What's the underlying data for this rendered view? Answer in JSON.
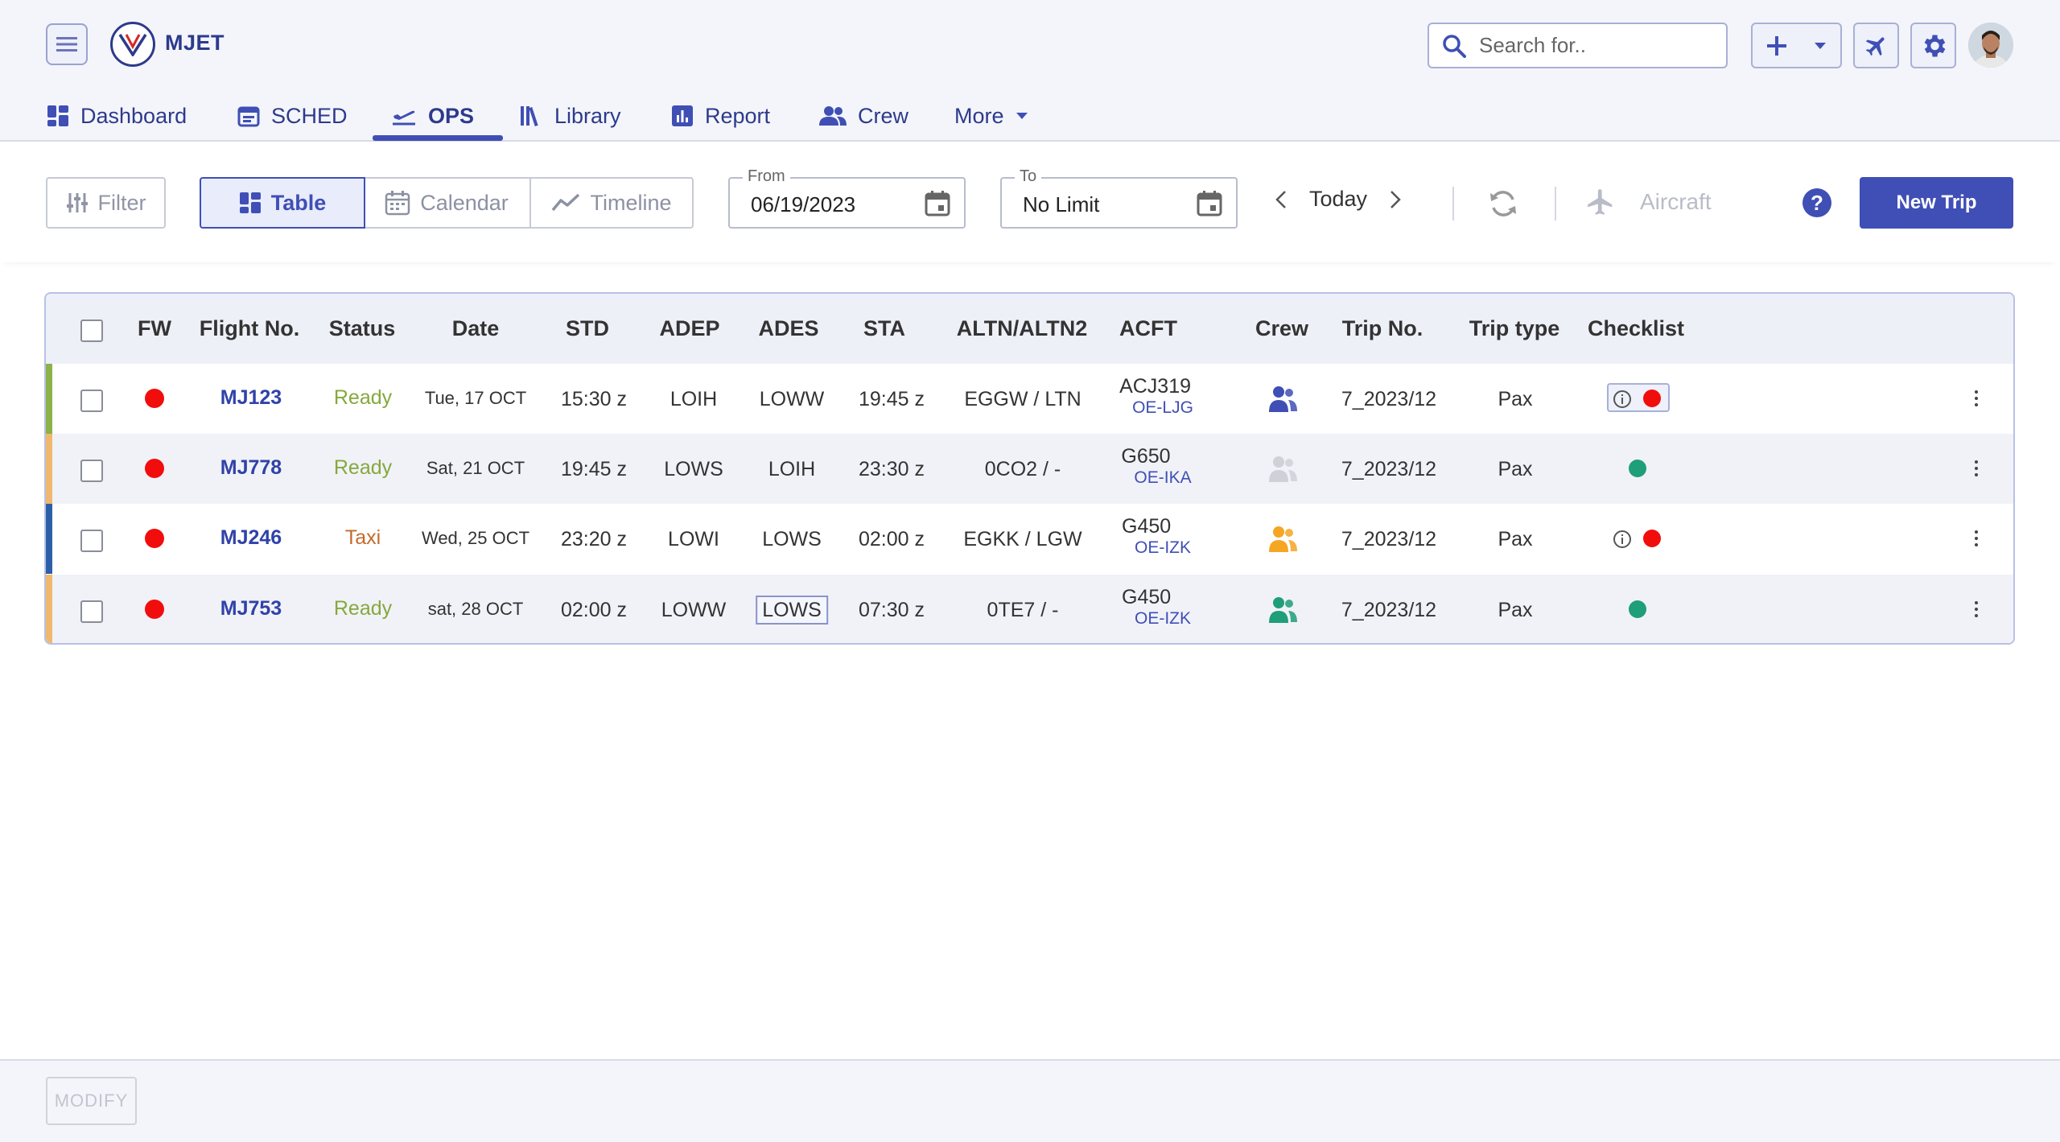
{
  "app": {
    "brand": "MJET"
  },
  "search": {
    "placeholder": "Search for.."
  },
  "nav": {
    "dashboard": "Dashboard",
    "sched": "SCHED",
    "ops": "OPS",
    "library": "Library",
    "report": "Report",
    "crew": "Crew",
    "more": "More"
  },
  "toolbar": {
    "filter": "Filter",
    "view_table": "Table",
    "view_calendar": "Calendar",
    "view_timeline": "Timeline",
    "from_label": "From",
    "from_value": "06/19/2023",
    "to_label": "To",
    "to_value": "No Limit",
    "today": "Today",
    "aircraft": "Aircraft",
    "help": "?",
    "new_trip": "New Trip"
  },
  "table": {
    "headers": {
      "fw": "FW",
      "flight": "Flight No.",
      "status": "Status",
      "date": "Date",
      "std": "STD",
      "adep": "ADEP",
      "ades": "ADES",
      "sta": "STA",
      "altn": "ALTN/ALTN2",
      "acft": "ACFT",
      "crew": "Crew",
      "trip": "Trip No.",
      "trip_type": "Trip type",
      "checklist": "Checklist"
    },
    "rows": [
      {
        "flight": "MJ123",
        "status": "Ready",
        "date": "Tue, 17 OCT",
        "std": "15:30 z",
        "adep": "LOIH",
        "ades": "LOWW",
        "sta": "19:45 z",
        "altn": "EGGW / LTN",
        "acft_type": "ACJ319",
        "acft_reg": "OE-LJG",
        "trip": "7_2023/12",
        "trip_type": "Pax",
        "bar_color": "#8bb34a",
        "crew_color": "#3f4fb5",
        "checklist": "info-red"
      },
      {
        "flight": "MJ778",
        "status": "Ready",
        "date": "Sat, 21 OCT",
        "std": "19:45 z",
        "adep": "LOWS",
        "ades": "LOIH",
        "sta": "23:30 z",
        "altn": "0CO2 / -",
        "acft_type": "G650",
        "acft_reg": "OE-IKA",
        "trip": "7_2023/12",
        "trip_type": "Pax",
        "bar_color": "#f0b86e",
        "crew_color": "#cfd1d8",
        "checklist": "green"
      },
      {
        "flight": "MJ246",
        "status": "Taxi",
        "date": "Wed, 25 OCT",
        "std": "23:20 z",
        "adep": "LOWI",
        "ades": "LOWS",
        "sta": "02:00 z",
        "altn": "EGKK / LGW",
        "acft_type": "G450",
        "acft_reg": "OE-IZK",
        "trip": "7_2023/12",
        "trip_type": "Pax",
        "bar_color": "#2d5fa8",
        "crew_color": "#f5a623",
        "checklist": "info-red"
      },
      {
        "flight": "MJ753",
        "status": "Ready",
        "date": "sat, 28 OCT",
        "std": "02:00 z",
        "adep": "LOWW",
        "ades": "LOWS",
        "sta": "07:30 z",
        "altn": "0TE7 / -",
        "acft_type": "G450",
        "acft_reg": "OE-IZK",
        "trip": "7_2023/12",
        "trip_type": "Pax",
        "bar_color": "#f0b86e",
        "crew_color": "#1f9e7a",
        "checklist": "green"
      }
    ]
  },
  "footer": {
    "modify": "MODIFY"
  },
  "colors": {
    "primary": "#3f4fb5",
    "fw_red": "#f20d0d",
    "ok_green": "#1f9e7a"
  }
}
